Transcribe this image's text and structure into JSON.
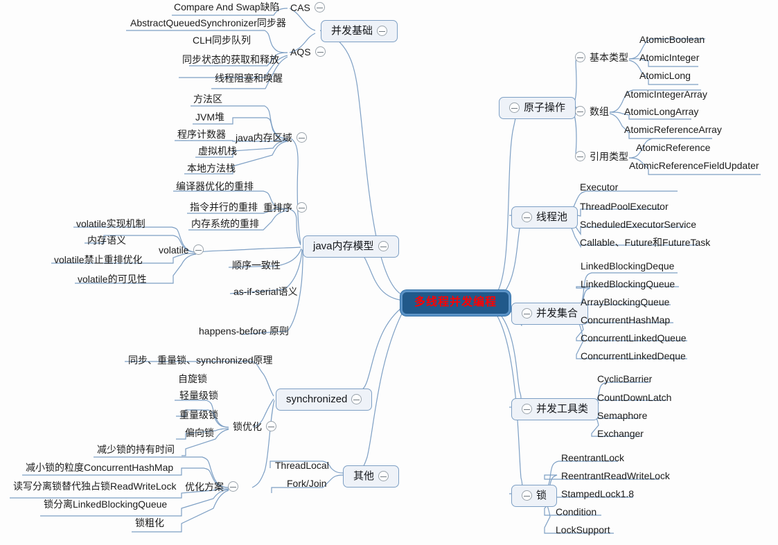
{
  "document": {
    "type": "mind-map",
    "title": "多线程并发编程",
    "background": "#fdfdfd",
    "accent": "#7d9fc4",
    "root_fill": "#21598a",
    "root_text_color": "#ff0000",
    "node_fill": "#eef2f8",
    "link_color": "#7d9fc4"
  },
  "root": {
    "label": "多线程并发编程"
  },
  "branches": {
    "concurrency_basics": {
      "label": "并发基础",
      "children": {
        "cas": {
          "label": "CAS",
          "children": [
            "Compare And Swap缺陷"
          ]
        },
        "aqs": {
          "label": "AQS",
          "children": [
            "AbstractQueuedSynchronizer同步器",
            "CLH同步队列",
            "同步状态的获取和释放",
            "线程阻塞和唤醒"
          ]
        }
      }
    },
    "java_memory_model": {
      "label": "java内存模型",
      "children": {
        "memory_area": {
          "label": "java内存区域",
          "children": [
            "方法区",
            "JVM堆",
            "程序计数器",
            "虚拟机栈",
            "本地方法栈"
          ]
        },
        "reorder": {
          "label": "重排序",
          "children": [
            "编译器优化的重排",
            "指令并行的重排",
            "内存系统的重排"
          ]
        },
        "volatile": {
          "label": "volatile",
          "children": [
            "volatile实现机制",
            "内存语义",
            "volatile禁止重排优化",
            "volatile的可见性"
          ]
        },
        "sequential_consistency": {
          "label": "顺序一致性"
        },
        "as_if_serial": {
          "label": "as-if-serial语义"
        },
        "happens_before": {
          "label": "happens-before 原则"
        }
      }
    },
    "synchronized": {
      "label": "synchronized",
      "children": {
        "principle": {
          "label": "同步、重量锁、synchronized原理"
        },
        "lock_optimization": {
          "label": "锁优化",
          "children": [
            "自旋锁",
            "轻量级锁",
            "重量级锁",
            "偏向锁"
          ]
        },
        "optimization_plan": {
          "label": "优化方案",
          "children": [
            "减少锁的持有时间",
            "减小锁的粒度ConcurrentHashMap",
            "读写分离锁替代独占锁ReadWriteLock",
            "锁分离LinkedBlockingQueue",
            "锁粗化"
          ]
        }
      }
    },
    "other": {
      "label": "其他",
      "children": [
        "ThreadLocal",
        "Fork/Join"
      ]
    },
    "atomic_operations": {
      "label": "原子操作",
      "children": {
        "primitive": {
          "label": "基本类型",
          "children": [
            "AtomicBoolean",
            "AtomicInteger",
            "AtomicLong"
          ]
        },
        "array": {
          "label": "数组",
          "children": [
            "AtomicIntegerArray",
            "AtomicLongArray",
            "AtomicReferenceArray"
          ]
        },
        "reference": {
          "label": "引用类型",
          "children": [
            "AtomicReference",
            "AtomicReferenceFieldUpdater"
          ]
        }
      }
    },
    "thread_pool": {
      "label": "线程池",
      "children": [
        "Executor",
        "ThreadPoolExecutor",
        "ScheduledExecutorService",
        "Callable、Future和FutureTask"
      ]
    },
    "concurrent_collections": {
      "label": "并发集合",
      "children": [
        "LinkedBlockingDeque",
        "LinkedBlockingQueue",
        "ArrayBlockingQueue",
        "ConcurrentHashMap",
        "ConcurrentLinkedQueue",
        "ConcurrentLinkedDeque"
      ]
    },
    "concurrent_tools": {
      "label": "并发工具类",
      "children": [
        "CyclicBarrier",
        "CountDownLatch",
        "Semaphore",
        "Exchanger"
      ]
    },
    "locks": {
      "label": "锁",
      "children": [
        "ReentrantLock",
        "ReentrantReadWriteLock",
        "StampedLock1.8",
        "Condition",
        "LockSupport"
      ]
    }
  }
}
